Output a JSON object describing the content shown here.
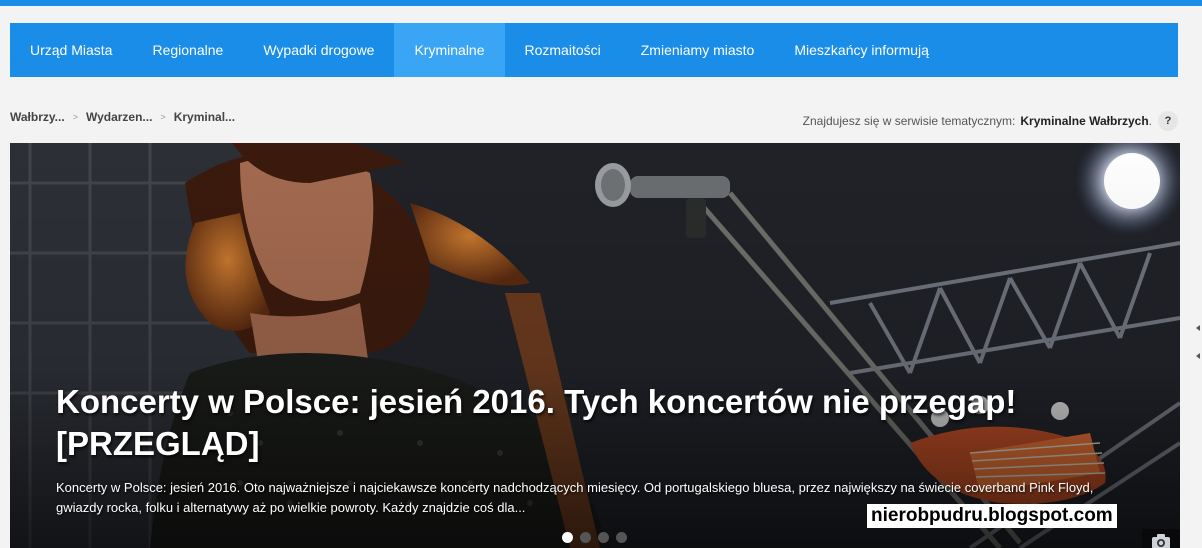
{
  "nav": {
    "items": [
      {
        "label": "Urząd Miasta"
      },
      {
        "label": "Regionalne"
      },
      {
        "label": "Wypadki drogowe"
      },
      {
        "label": "Kryminalne",
        "active": true
      },
      {
        "label": "Rozmaitości"
      },
      {
        "label": "Zmieniamy miasto"
      },
      {
        "label": "Mieszkańcy informują"
      }
    ]
  },
  "breadcrumb": [
    "Wałbrzy...",
    "Wydarzen...",
    "Kryminal..."
  ],
  "breadcrumb_separator": ">",
  "service": {
    "prefix": "Znajdujesz się w serwisie tematycznym:",
    "name": "Kryminalne Wałbrzych",
    "suffix": ".",
    "help_label": "?"
  },
  "hero": {
    "title": "Koncerty w Polsce: jesień 2016. Tych koncertów nie przegap! [PRZEGLĄD]",
    "description": "Koncerty w Polsce: jesień 2016. Oto najważniejsze i najciekawsze koncerty nadchodzących miesięcy. Od portugalskiego bluesa, przez największy na świecie coverband Pink Floyd, gwiazdy rocka, folku i alternatywy aż po wielkie powroty. Każdy znajdzie coś dla...",
    "slides": 4,
    "active_slide": 0,
    "camera_icon": "camera-icon"
  },
  "watermark": "nierobpudru.blogspot.com",
  "colors": {
    "nav_bg": "#1a8de9",
    "nav_active": "#3aa5f5",
    "page_bg": "#f3f3f3"
  }
}
